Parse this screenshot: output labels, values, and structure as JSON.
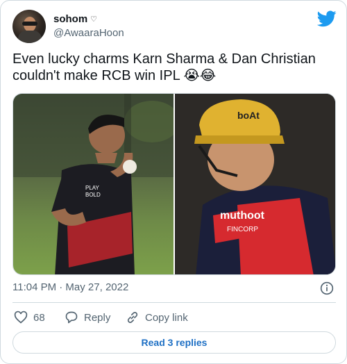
{
  "user": {
    "name": "sohom",
    "name_emoji": "♡",
    "handle": "@AwaaraHoon"
  },
  "tweet": {
    "text": "Even lucky charms Karn Sharma & Dan Christian couldn't make RCB win IPL 😭😂"
  },
  "media": {
    "left_jersey_text": "PLAY BOLD",
    "right_helmet_text": "boAt",
    "right_jersey_sponsor": "muthoot",
    "right_jersey_sub": "FINCORP"
  },
  "timestamp": "11:04 PM · May 27, 2022",
  "actions": {
    "like_count": "68",
    "reply_label": "Reply",
    "copy_label": "Copy link"
  },
  "read_replies_label": "Read 3 replies",
  "colors": {
    "accent": "#1d9bf0",
    "link": "#1d6fc4",
    "muted": "#536471",
    "border": "#cfd9de"
  }
}
